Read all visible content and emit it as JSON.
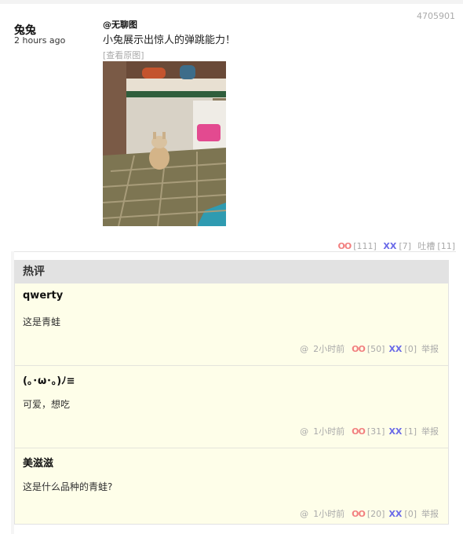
{
  "post": {
    "id": "4705901",
    "author": "兔兔",
    "time": "2 hours ago",
    "mention": "@无聊图",
    "content": "小兔展示出惊人的弹跳能力！",
    "view_original": "[查看原图]",
    "oo_label": "OO",
    "oo_count": "[111]",
    "xx_label": "XX",
    "xx_count": "[7]",
    "tucao_label": "吐槽",
    "tucao_count": "[11]"
  },
  "hot_comments": {
    "title": "热评",
    "items": [
      {
        "author": "qwerty",
        "text": "这是青蛙",
        "at": "@",
        "time": "2小时前",
        "oo": "OO",
        "oo_count": "[50]",
        "xx": "XX",
        "xx_count": "[0]",
        "report": "举报"
      },
      {
        "author": "(｡･ω･｡)ﾉ≡",
        "text": "可爱，想吃",
        "at": "@",
        "time": "1小时前",
        "oo": "OO",
        "oo_count": "[31]",
        "xx": "XX",
        "xx_count": "[1]",
        "report": "举报"
      },
      {
        "author": "美滋滋",
        "text": "这是什么品种的青蛙?",
        "at": "@",
        "time": "1小时前",
        "oo": "OO",
        "oo_count": "[20]",
        "xx": "XX",
        "xx_count": "[0]",
        "report": "举报"
      }
    ]
  }
}
